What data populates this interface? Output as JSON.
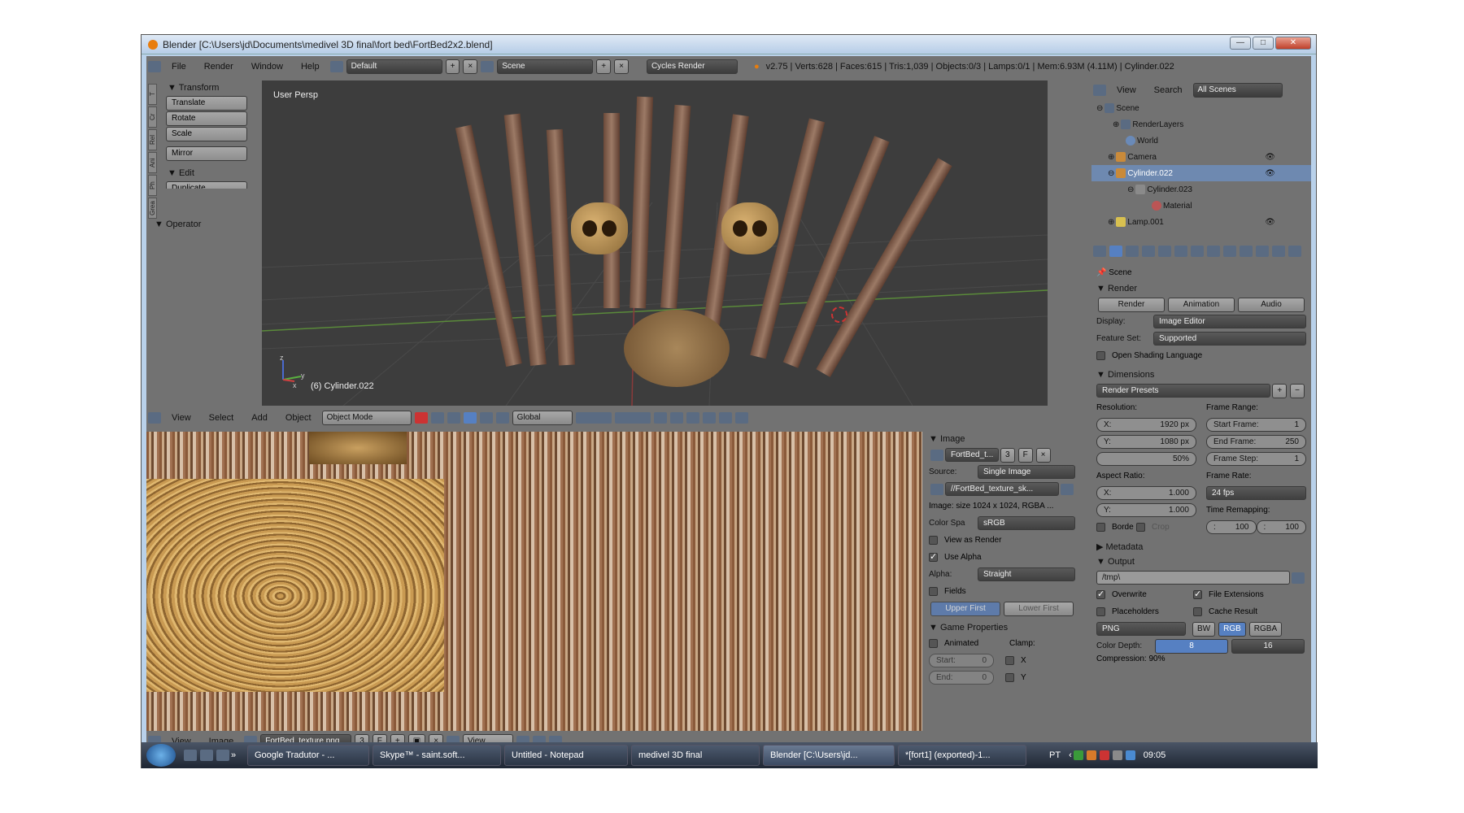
{
  "window": {
    "title": "Blender [C:\\Users\\jd\\Documents\\medivel 3D final\\fort bed\\FortBed2x2.blend]",
    "min": "—",
    "max": "□",
    "close": "✕"
  },
  "infobar": {
    "menus": [
      "File",
      "Render",
      "Window",
      "Help"
    ],
    "layout": "Default",
    "scene": "Scene",
    "engine": "Cycles Render",
    "stats": "v2.75 | Verts:628 | Faces:615 | Tris:1,039 | Objects:0/3 | Lamps:0/1 | Mem:6.93M (4.11M) | Cylinder.022"
  },
  "toolshelf": {
    "tabs": [
      "T",
      "Cr",
      "Rel",
      "Ani",
      "Ph",
      "Grea"
    ],
    "transform_title": "Transform",
    "transform_items": [
      "Translate",
      "Rotate",
      "Scale",
      "Mirror"
    ],
    "edit_title": "Edit",
    "edit_items": [
      "Duplicate"
    ],
    "operator_title": "Operator"
  },
  "viewport": {
    "view_label": "User Persp",
    "object_label": "(6) Cylinder.022",
    "axis_x": "x",
    "axis_y": "y",
    "axis_z": "z"
  },
  "view3d_header": {
    "menus": [
      "View",
      "Select",
      "Add",
      "Object"
    ],
    "mode": "Object Mode",
    "orientation": "Global"
  },
  "image_editor": {
    "menus": [
      "View",
      "Image"
    ],
    "image_name": "FortBed_texture.png",
    "users": "3",
    "fake": "F",
    "view": "View"
  },
  "image_panel": {
    "title": "Image",
    "datablock": "FortBed_t...",
    "users": "3",
    "fake": "F",
    "source_label": "Source:",
    "source": "Single Image",
    "filepath": "//FortBed_texture_sk...",
    "info": "Image: size 1024 x 1024, RGBA ...",
    "colorspace_label": "Color Spa",
    "colorspace": "sRGB",
    "view_as_render": "View as Render",
    "use_alpha": "Use Alpha",
    "alpha_label": "Alpha:",
    "alpha": "Straight",
    "fields": "Fields",
    "upper_first": "Upper First",
    "lower_first": "Lower First",
    "game_title": "Game Properties",
    "animated": "Animated",
    "clamp": "Clamp:",
    "start_label": "Start:",
    "start": "0",
    "end_label": "End:",
    "end": "0",
    "clamp_x": "X",
    "clamp_y": "Y"
  },
  "outliner": {
    "menus": [
      "View",
      "Search"
    ],
    "filter": "All Scenes",
    "items": [
      {
        "label": "Scene",
        "indent": 0
      },
      {
        "label": "RenderLayers",
        "indent": 1
      },
      {
        "label": "World",
        "indent": 1
      },
      {
        "label": "Camera",
        "indent": 1
      },
      {
        "label": "Cylinder.022",
        "indent": 1
      },
      {
        "label": "Cylinder.023",
        "indent": 2
      },
      {
        "label": "Material",
        "indent": 3
      },
      {
        "label": "Lamp.001",
        "indent": 1
      }
    ]
  },
  "properties": {
    "context": "Scene",
    "render_title": "Render",
    "render_btns": [
      "Render",
      "Animation",
      "Audio"
    ],
    "display_label": "Display:",
    "display": "Image Editor",
    "feature_label": "Feature Set:",
    "feature": "Supported",
    "osl": "Open Shading Language",
    "dimensions_title": "Dimensions",
    "presets": "Render Presets",
    "resolution_label": "Resolution:",
    "res_x_label": "X:",
    "res_x": "1920 px",
    "res_y_label": "Y:",
    "res_y": "1080 px",
    "res_pct": "50%",
    "frame_range_label": "Frame Range:",
    "start_frame_label": "Start Frame:",
    "start_frame": "1",
    "end_frame_label": "End Frame:",
    "end_frame": "250",
    "frame_step_label": "Frame Step:",
    "frame_step": "1",
    "aspect_label": "Aspect Ratio:",
    "asp_x": "1.000",
    "asp_y": "1.000",
    "frame_rate_label": "Frame Rate:",
    "frame_rate": "24 fps",
    "border": "Borde",
    "crop": "Crop",
    "remap_label": "Time Remapping:",
    "remap_old": "100",
    "remap_new": "100",
    "metadata_title": "Metadata",
    "output_title": "Output",
    "output_path": "/tmp\\",
    "overwrite": "Overwrite",
    "file_ext": "File Extensions",
    "placeholders": "Placeholders",
    "cache": "Cache Result",
    "format": "PNG",
    "bw": "BW",
    "rgb": "RGB",
    "rgba": "RGBA",
    "depth_label": "Color Depth:",
    "depth_8": "8",
    "depth_16": "16",
    "compression": "Compression: 90%"
  },
  "taskbar": {
    "items": [
      "Google Tradutor - ...",
      "Skype™ - saint.soft...",
      "Untitled - Notepad",
      "medivel 3D final",
      "Blender [C:\\Users\\jd...",
      "*[fort1] (exported)-1..."
    ],
    "lang": "PT",
    "clock": "09:05"
  }
}
